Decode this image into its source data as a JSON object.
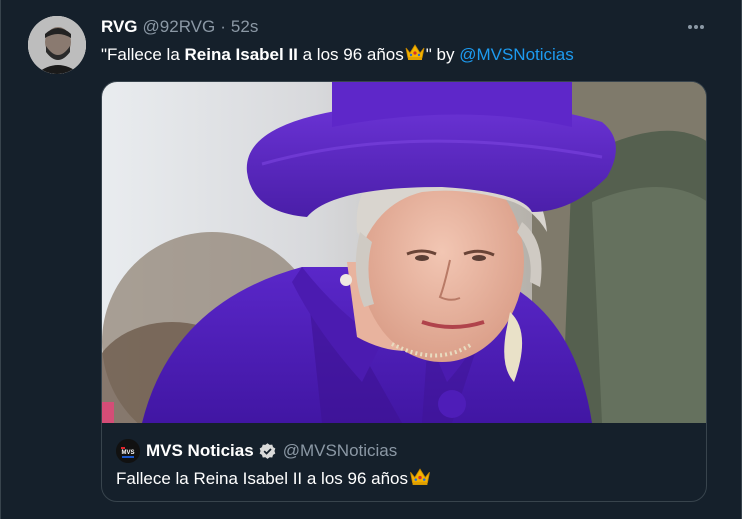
{
  "tweet": {
    "author": {
      "display_name": "RVG",
      "handle": "@92RVG",
      "separator": "·",
      "time": "52s"
    },
    "text": {
      "open_quote": "\"Fallece la ",
      "bold": "Reina Isabel II",
      "rest": " a los 96 años",
      "close": "\" by ",
      "mention": "@MVSNoticias"
    },
    "more_icon": "more-horizontal-icon"
  },
  "quoted_tweet": {
    "author": {
      "display_name": "MVS Noticias",
      "handle": "@MVSNoticias",
      "logo_text": "MVS"
    },
    "text": "Fallece la Reina Isabel II a los 96 años",
    "verified_icon": "verified-badge-icon"
  },
  "colors": {
    "background": "#15202b",
    "border": "#38444d",
    "text_primary": "#ffffff",
    "text_secondary": "#8b98a5",
    "link": "#1d9bf0",
    "hat_purple": "#5b22b3"
  }
}
